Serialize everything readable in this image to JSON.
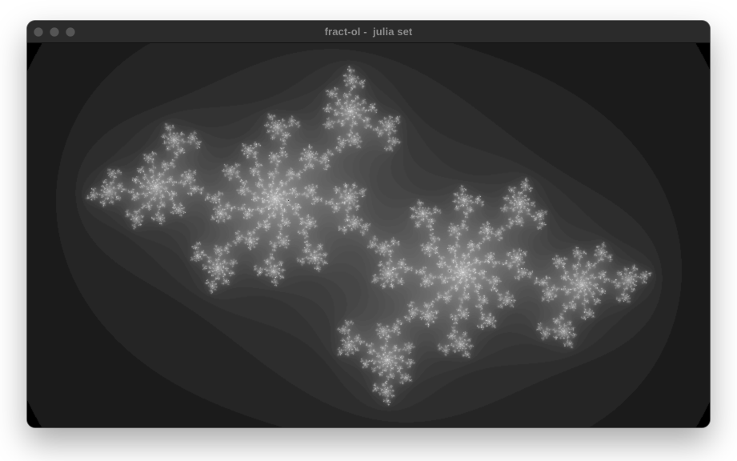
{
  "window": {
    "title": "fract-ol -  julia set",
    "buttons": [
      {
        "name": "close",
        "icon": "circle-icon"
      },
      {
        "name": "minimize",
        "icon": "circle-icon"
      },
      {
        "name": "zoom",
        "icon": "circle-icon"
      }
    ],
    "button_color": "#555555",
    "titlebar_color": "#2b2b2b",
    "title_color": "#8a8a8a"
  },
  "fractal": {
    "colors": {
      "background": "#000000",
      "foreground": "#ffffff"
    }
  }
}
